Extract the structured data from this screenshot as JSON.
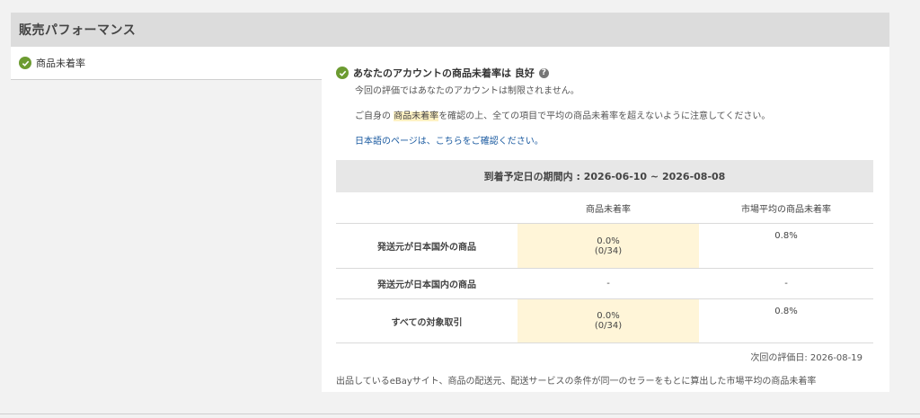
{
  "header": {
    "title": "販売パフォーマンス"
  },
  "left_nav": {
    "item_label": "商品未着率"
  },
  "status": {
    "title": "あなたのアカウントの商品未着率は 良好",
    "line1": "今回の評価ではあなたのアカウントは制限されません。",
    "line2_prefix": "ご自身の ",
    "line2_highlight": "商品未着率",
    "line2_suffix": "を確認の上、全ての項目で平均の商品未着率を超えないように注意してください。",
    "link": "日本語のページは、こちらをご確認ください。"
  },
  "period": {
    "label": "到着予定日の期間内 : 2026-06-10 ~ 2026-08-08"
  },
  "table": {
    "headers": [
      "",
      "商品未着率",
      "市場平均の商品未着率"
    ],
    "rows": [
      {
        "label": "発送元が日本国外の商品",
        "rate": "0.0%",
        "count": "(0/34)",
        "market": "0.8%"
      },
      {
        "label": "発送元が日本国内の商品",
        "rate": "-",
        "count": "",
        "market": "-"
      },
      {
        "label": "すべての対象取引",
        "rate": "0.0%",
        "count": "(0/34)",
        "market": "0.8%"
      }
    ]
  },
  "next_evaluation": "次回の評価日: 2026-08-19",
  "footnote": "出品しているeBayサイト、商品の配送元、配送サービスの条件が同一のセラーをもとに算出した市場平均の商品未着率",
  "colors": {
    "success": "#6c9b31",
    "highlight": "#fff5d8",
    "link": "#1a5aa0",
    "header_bg": "#dcdcdc"
  },
  "icons": {
    "status": "check-circle-icon",
    "help": "question-circle-icon"
  }
}
